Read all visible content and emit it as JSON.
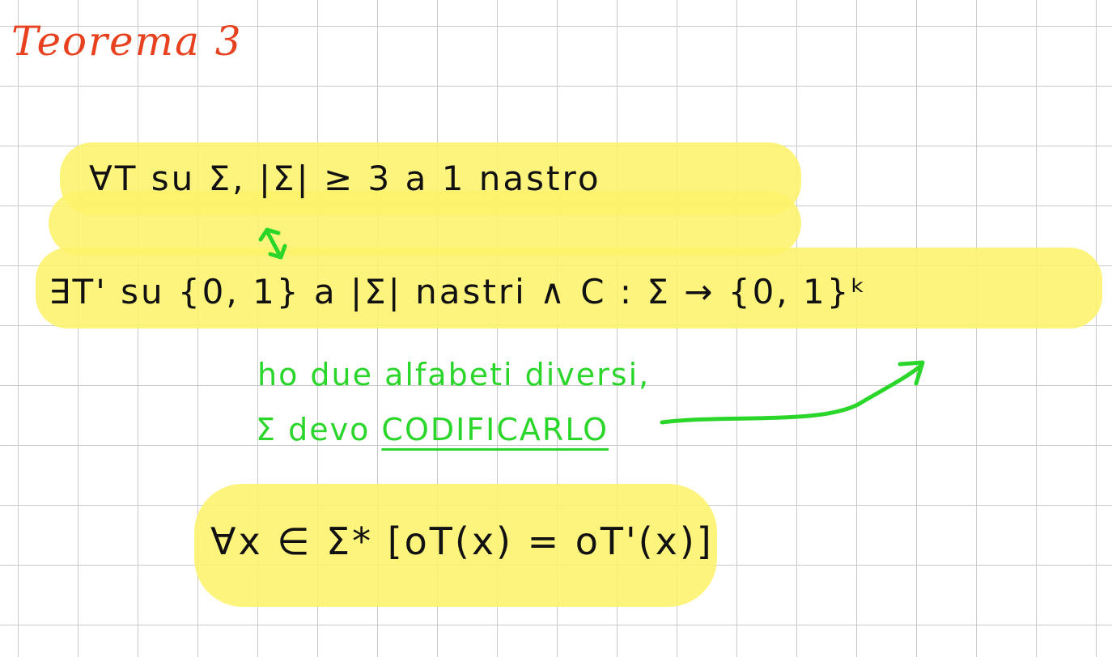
{
  "note": {
    "title": "Teorema 3",
    "line1": "∀T su Σ, |Σ| ≥ 3 a 1 nastro",
    "line2": "∃T' su {0, 1} a |Σ| nastri ∧ C : Σ → {0, 1}ᵏ",
    "note1": "ho due alfabeti diversi,",
    "note2_prefix": "Σ devo ",
    "note2_emph": "CODIFICARLO",
    "line3": "∀x ∈ Σ* [oT(x) = oT'(x)]"
  },
  "colors": {
    "title_ink": "#e8411f",
    "body_ink": "#111111",
    "annotation_ink": "#2bd62b",
    "highlight": "#fdf36b",
    "grid": "#c9c9c9"
  }
}
